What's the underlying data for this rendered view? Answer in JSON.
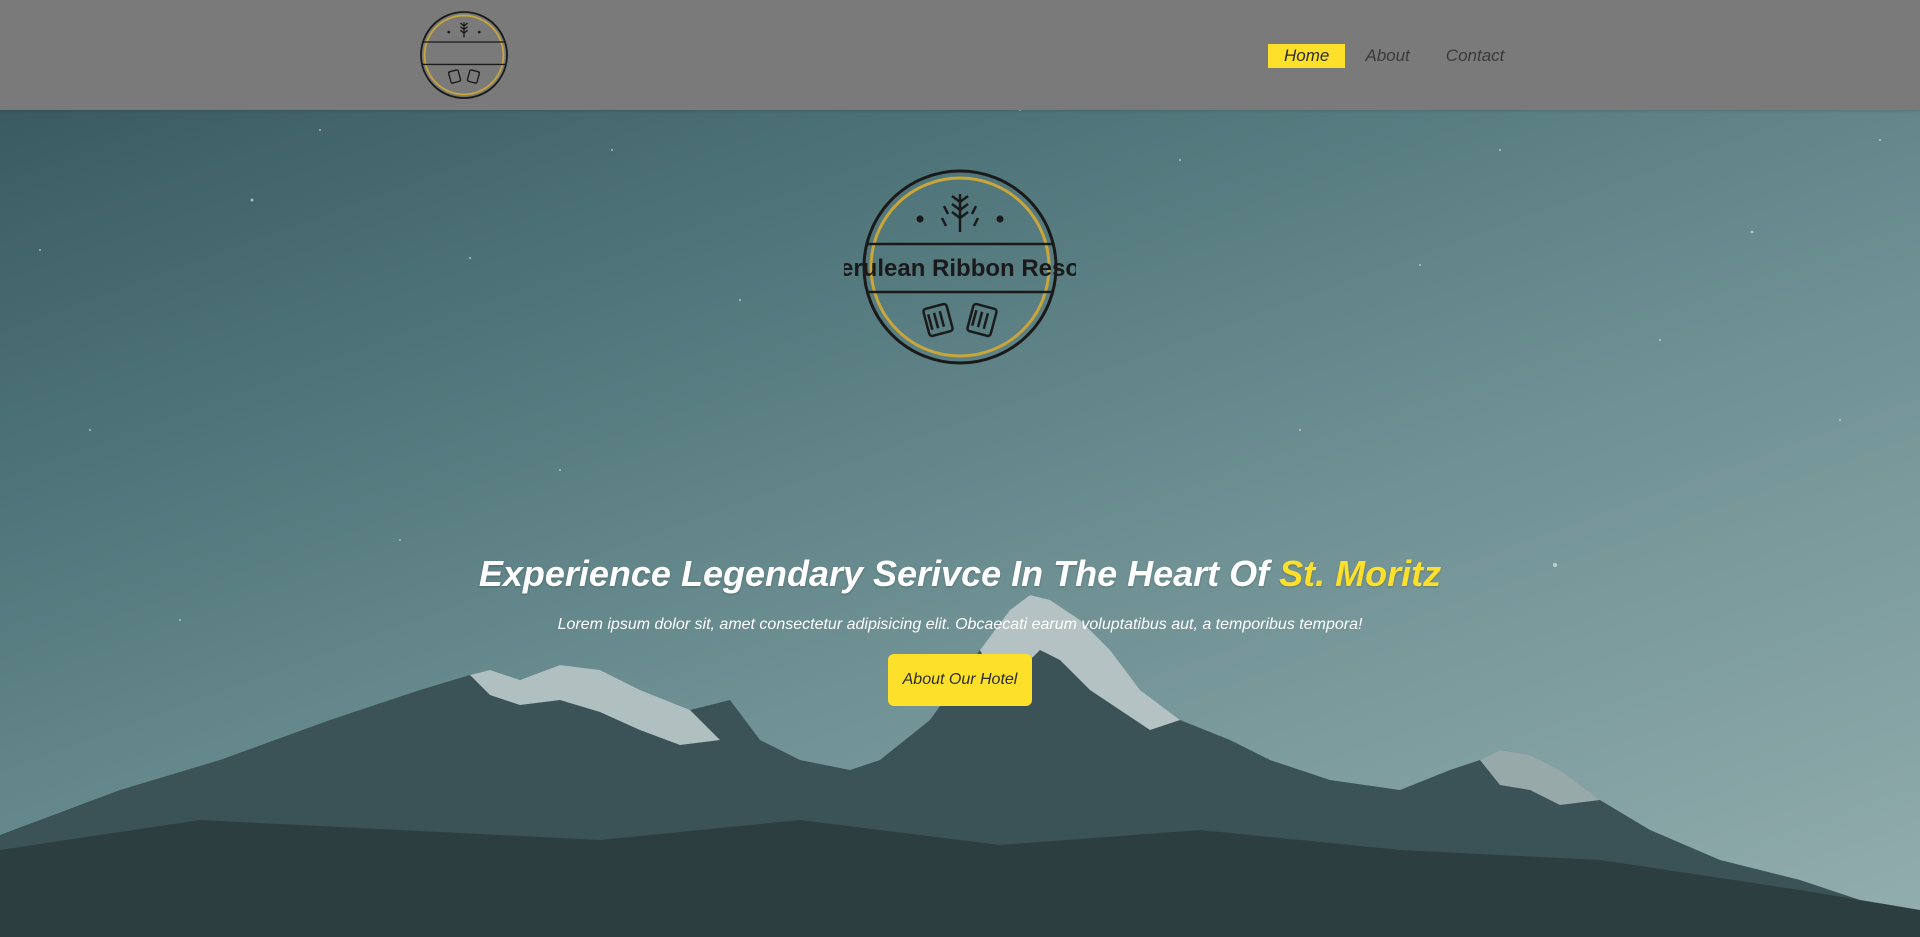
{
  "colors": {
    "accent": "#fce029",
    "header_bg": "#7a7a7a",
    "nav_text": "#3a3a3a",
    "logo_ring": "#c9a63a"
  },
  "brand": {
    "name": "Cerulean Ribbon Resort",
    "logo_icons": [
      "wheat-icon",
      "beer-mugs-icon"
    ]
  },
  "nav": {
    "items": [
      {
        "label": "Home",
        "active": true
      },
      {
        "label": "About",
        "active": false
      },
      {
        "label": "Contact",
        "active": false
      }
    ]
  },
  "hero": {
    "title_main": "Experience Legendary Serivce In The Heart Of ",
    "title_accent": "St. Moritz",
    "subtitle": "Lorem ipsum dolor sit, amet consectetur adipisicing elit. Obcaecati earum voluptatibus aut, a temporibus tempora!",
    "cta_label": "About Our Hotel",
    "background": "mountain-night-sky-image"
  }
}
